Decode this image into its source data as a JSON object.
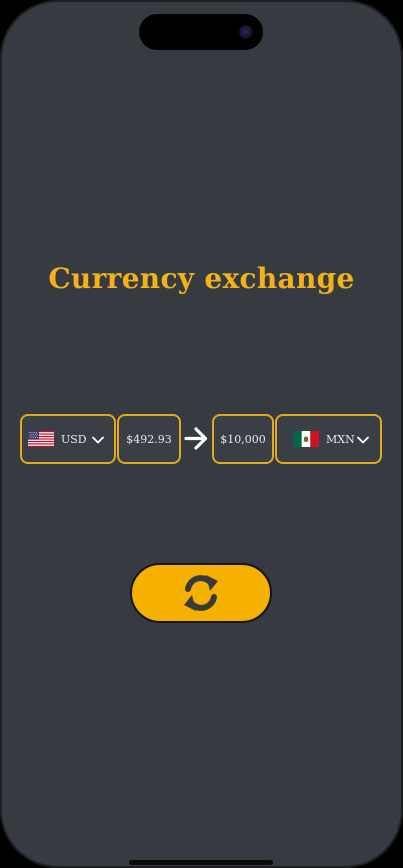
{
  "app": {
    "title": "Currency exchange"
  },
  "from_currency": {
    "code": "USD",
    "flag_icon": "us-flag-icon",
    "amount": "$492.93"
  },
  "to_currency": {
    "code": "MXN",
    "flag_icon": "mexico-flag-icon",
    "amount": "$10,000"
  },
  "icons": {
    "arrow": "arrow-right-icon",
    "dropdown": "chevron-down-icon",
    "swap": "refresh-icon"
  },
  "colors": {
    "background": "#363a41",
    "accent": "#f3b21a",
    "button": "#f5b000",
    "text": "#e9e9e9"
  }
}
